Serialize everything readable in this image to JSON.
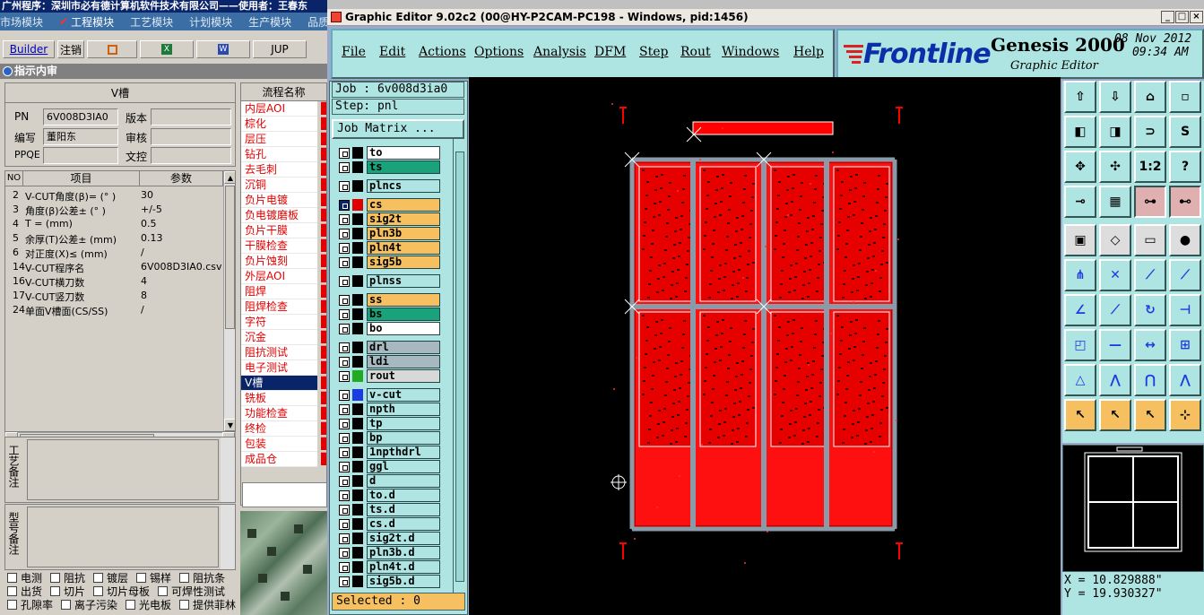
{
  "left_app": {
    "title": "广州程序：深圳市必有德计算机软件技术有限公司——使用者：王春东",
    "modules": [
      "市场模块",
      "工程模块",
      "工艺模块",
      "计划模块",
      "生产模块",
      "品质模"
    ],
    "toolbar": {
      "builder": "Builder",
      "logout": "注销",
      "jup": "JUP"
    },
    "section_title": "指示内审",
    "panel_title": "V槽",
    "fields": {
      "pn_label": "PN",
      "pn_value": "6V008D3IA0",
      "version_label": "版本",
      "version_value": "",
      "editor_label": "编写",
      "editor_value": "董阳东",
      "reviewer_label": "审核",
      "reviewer_value": "",
      "ppqe_label": "PPQE",
      "ppqe_value": "",
      "doc_label": "文控",
      "doc_value": ""
    },
    "table": {
      "headers": [
        "NO",
        "项目",
        "参数"
      ],
      "rows": [
        {
          "no": "2",
          "item": "V-CUT角度(β)=  (° )",
          "value": "30"
        },
        {
          "no": "3",
          "item": "角度(β)公差±  (° )",
          "value": "+/-5"
        },
        {
          "no": "4",
          "item": "T =  (mm)",
          "value": "0.5"
        },
        {
          "no": "5",
          "item": "余厚(T)公差±  (mm)",
          "value": "0.13"
        },
        {
          "no": "6",
          "item": "对正度(X)≤  (mm)",
          "value": "/"
        },
        {
          "no": "14",
          "item": "V-CUT程序名",
          "value": "6V008D3IA0.csv"
        },
        {
          "no": "16",
          "item": "V-CUT横刀数",
          "value": "4"
        },
        {
          "no": "17",
          "item": "V-CUT竖刀数",
          "value": "8"
        },
        {
          "no": "24",
          "item": "单面V槽面(CS/SS)",
          "value": "/"
        }
      ]
    },
    "note1_label": "工艺备注",
    "note2_label": "型号备注",
    "checks": [
      [
        "电测",
        "阻抗",
        "镀层",
        "锡样",
        "阻抗条"
      ],
      [
        "出货",
        "切片",
        "切片母板",
        "可焊性测试"
      ],
      [
        "孔隙率",
        "离子污染",
        "光电板",
        "提供菲林"
      ]
    ],
    "flow_header": "流程名称",
    "flow_items": [
      "内层AOI",
      "棕化",
      "层压",
      "钻孔",
      "去毛刺",
      "沉铜",
      "负片电镀",
      "负电镀磨板",
      "负片干膜",
      "干膜检查",
      "负片蚀刻",
      "外层AOI",
      "阻焊",
      "阻焊检查",
      "字符",
      "沉金",
      "阻抗测试",
      "电子测试",
      "V槽",
      "铣板",
      "功能检查",
      "终检",
      "包装",
      "成品仓"
    ],
    "flow_selected": "V槽"
  },
  "genesis": {
    "title": "Graphic Editor 9.02c2 (00@HY-P2CAM-PC198 - Windows, pid:1456)",
    "menu": [
      "File",
      "Edit",
      "Actions",
      "Options",
      "Analysis",
      "DFM",
      "Step",
      "Rout",
      "Windows",
      "Help"
    ],
    "logo": {
      "brand": "Frontline",
      "product": "Genesis 2000",
      "subtitle": "Graphic Editor",
      "date": "08 Nov 2012",
      "time": "09:34 AM"
    },
    "job": "Job : 6v008d3ia0",
    "step": "Step: pnl",
    "job_matrix": "Job Matrix ...",
    "layers": [
      {
        "name": "to",
        "color": "#ffffff"
      },
      {
        "name": "ts",
        "color": "#1aa37a"
      },
      {
        "name": "plncs",
        "color": "#aee4e1"
      },
      {
        "name": "cs",
        "color": "#f6c060",
        "highlight": true,
        "swatch": "#e00000"
      },
      {
        "name": "sig2t",
        "color": "#f6c060"
      },
      {
        "name": "pln3b",
        "color": "#f6c060"
      },
      {
        "name": "pln4t",
        "color": "#f6c060"
      },
      {
        "name": "sig5b",
        "color": "#f6c060"
      },
      {
        "name": "plnss",
        "color": "#aee4e1"
      },
      {
        "name": "ss",
        "color": "#f6c060"
      },
      {
        "name": "bs",
        "color": "#1aa37a"
      },
      {
        "name": "bo",
        "color": "#ffffff"
      },
      {
        "name": "drl",
        "color": "#a8b8c0"
      },
      {
        "name": "ldi",
        "color": "#a8b8c0"
      },
      {
        "name": "rout",
        "color": "#d8d8d8",
        "swatch": "#22aa22"
      },
      {
        "name": "v-cut",
        "color": "#aee4e1",
        "swatch": "#1a3ce0"
      },
      {
        "name": "npth",
        "color": "#aee4e1"
      },
      {
        "name": "tp",
        "color": "#aee4e1"
      },
      {
        "name": "bp",
        "color": "#aee4e1"
      },
      {
        "name": "1npthdrl",
        "color": "#aee4e1"
      },
      {
        "name": "ggl",
        "color": "#aee4e1"
      },
      {
        "name": "d",
        "color": "#aee4e1"
      },
      {
        "name": "to.d",
        "color": "#aee4e1"
      },
      {
        "name": "ts.d",
        "color": "#aee4e1"
      },
      {
        "name": "cs.d",
        "color": "#aee4e1"
      },
      {
        "name": "sig2t.d",
        "color": "#aee4e1"
      },
      {
        "name": "pln3b.d",
        "color": "#aee4e1"
      },
      {
        "name": "pln4t.d",
        "color": "#aee4e1"
      },
      {
        "name": "sig5b.d",
        "color": "#aee4e1"
      }
    ],
    "selected": "Selected : 0",
    "tools_text": {
      "scale": "1:2",
      "query": "?"
    },
    "coords": {
      "x": "X = 10.829888\"",
      "y": "Y = 19.930327\""
    }
  }
}
